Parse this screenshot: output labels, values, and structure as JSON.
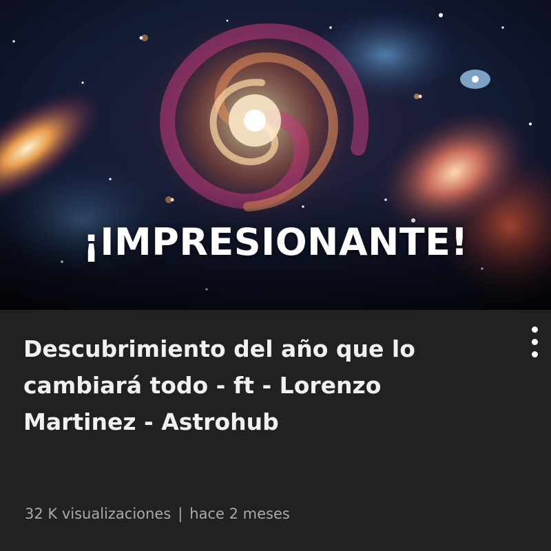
{
  "thumbnail": {
    "overlay_text": "¡IMPRESIONANTE!",
    "description_icon": "galaxy-image"
  },
  "video": {
    "title": "Descubrimiento del año que lo cambiará todo - ft - Lorenzo Martinez - Astrohub",
    "views": "32  K visualizaciones",
    "separator": "|",
    "age": "hace 2 meses"
  },
  "menu": {
    "icon": "more-vertical-icon"
  },
  "colors": {
    "background": "#212121",
    "title": "#f1f1f1",
    "meta": "#aaaaaa"
  }
}
